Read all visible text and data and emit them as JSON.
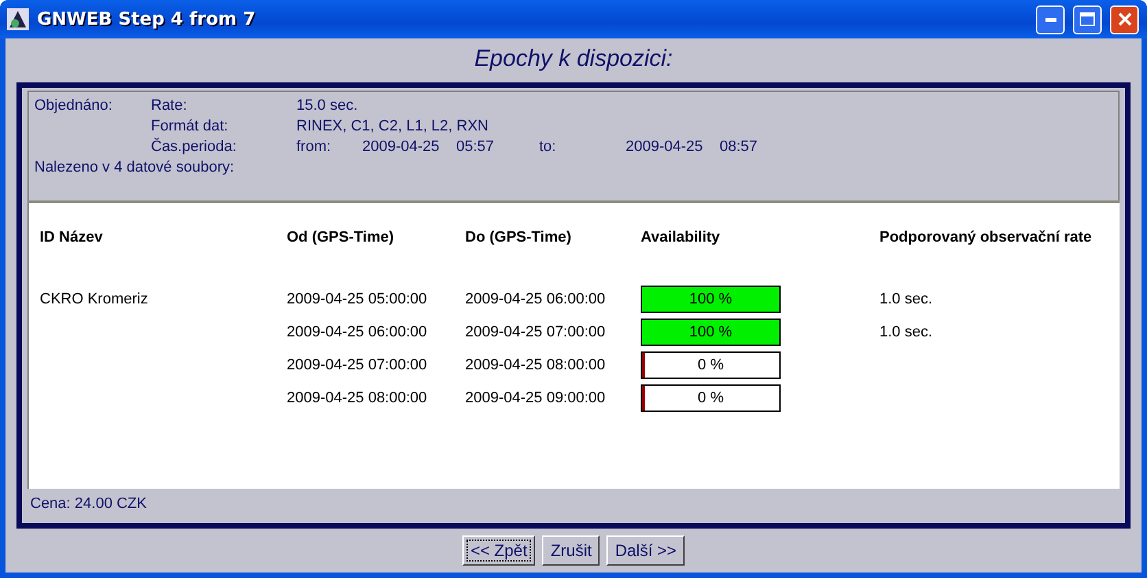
{
  "window": {
    "title": "GNWEB Step 4 from 7"
  },
  "heading": "Epochy k dispozici:",
  "order": {
    "label": "Objednáno:",
    "rate_label": "Rate:",
    "rate": "15.0 sec.",
    "format_label": "Formát dat:",
    "format": "RINEX, C1, C2, L1, L2, RXN",
    "period_label": "Čas.perioda:",
    "from_label": "from:",
    "from_date": "2009-04-25",
    "from_time": "05:57",
    "to_label": "to:",
    "to_date": "2009-04-25",
    "to_time": "08:57",
    "found": "Nalezeno v  4 datové soubory:"
  },
  "table": {
    "columns": [
      "ID  Název",
      "Od (GPS-Time)",
      "Do (GPS-Time)",
      "Availability",
      "Podporovaný observační rate"
    ],
    "rows": [
      {
        "station": "CKRO  Kromeriz",
        "from": "2009-04-25  05:00:00",
        "to": "2009-04-25  06:00:00",
        "level": 1,
        "percent": "100 %",
        "rate": "1.0 sec."
      },
      {
        "station": "",
        "from": "2009-04-25  06:00:00",
        "to": "2009-04-25  07:00:00",
        "level": 1,
        "percent": "100 %",
        "rate": "1.0 sec."
      },
      {
        "station": "",
        "from": "2009-04-25  07:00:00",
        "to": "2009-04-25  08:00:00",
        "level": 0,
        "percent": "0 %",
        "rate": ""
      },
      {
        "station": "",
        "from": "2009-04-25  08:00:00",
        "to": "2009-04-25  09:00:00",
        "level": 0,
        "percent": "0 %",
        "rate": ""
      }
    ]
  },
  "price": "Cena: 24.00 CZK",
  "buttons": [
    {
      "label": "<< Zpět",
      "focused": true
    },
    {
      "label": "Zrušit",
      "focused": false
    },
    {
      "label": "Další >>",
      "focused": false
    }
  ]
}
